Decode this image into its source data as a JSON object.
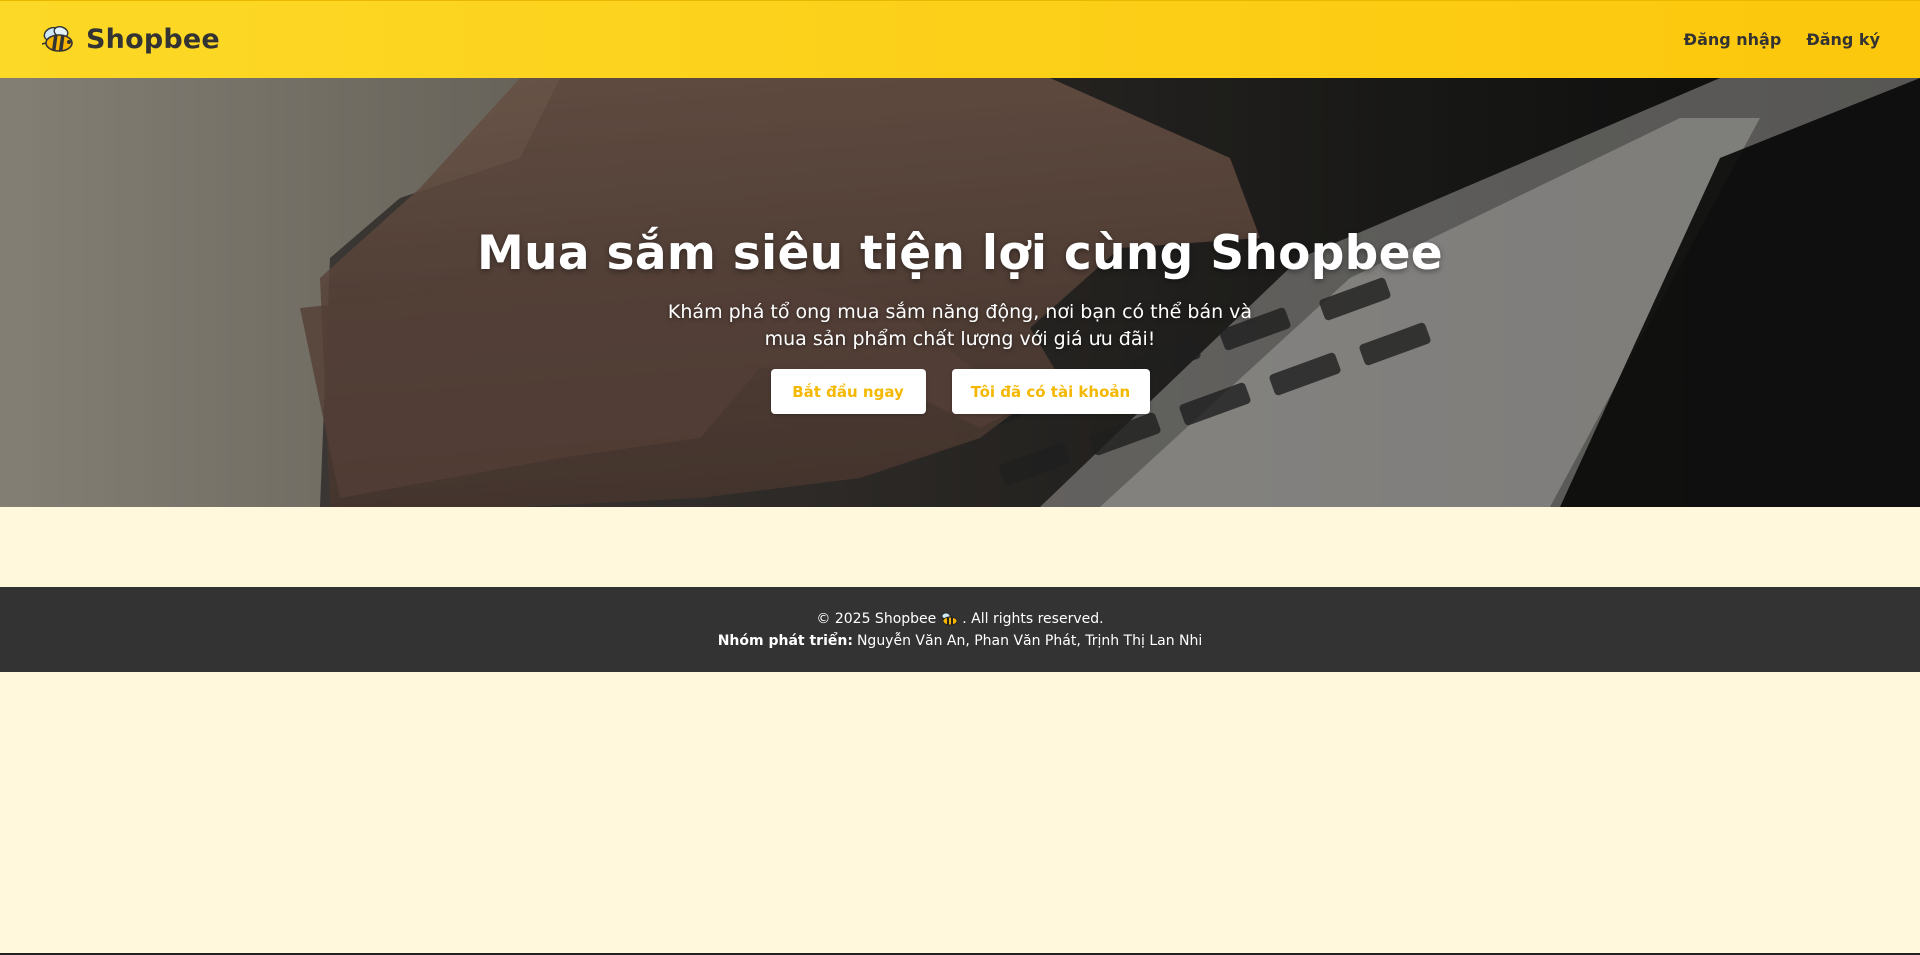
{
  "header": {
    "brand_name": "Shopbee",
    "brand_icon": "bee-icon",
    "login_label": "Đăng nhập",
    "register_label": "Đăng ký"
  },
  "hero": {
    "title": "Mua sắm siêu tiện lợi cùng Shopbee",
    "subtitle": "Khám phá tổ ong mua sắm năng động, nơi bạn có thể bán và mua sản phẩm chất lượng với giá ưu đãi!",
    "start_button": "Bắt đầu ngay",
    "have_account_button": "Tôi đã có tài khoản"
  },
  "footer": {
    "copyright_prefix": "© 2025 Shopbee",
    "copyright_suffix": ". All rights reserved.",
    "team_label": "Nhóm phát triển:",
    "team_members": "Nguyễn Văn An, Phan Văn Phát, Trịnh Thị Lan Nhi"
  },
  "colors": {
    "navbar_start": "#fcd926",
    "navbar_end": "#fcc70c",
    "accent": "#f5b800",
    "page_background": "#fff8dc",
    "footer_background": "#333333"
  }
}
